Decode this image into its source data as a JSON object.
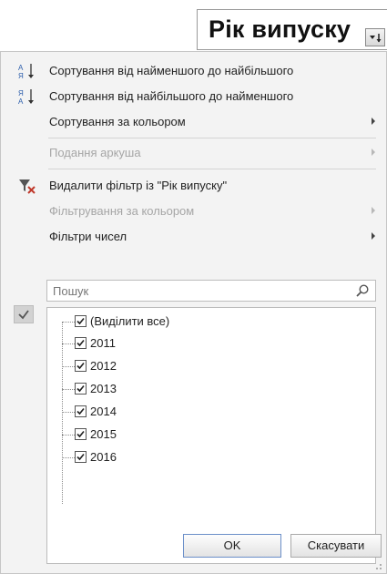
{
  "header": {
    "title": "Рік випуску"
  },
  "menu": {
    "items": [
      {
        "label": "Сортування від найменшого до найбільшого",
        "enabled": true,
        "submenu": false,
        "icon": "sort-ascending-icon"
      },
      {
        "label": "Сортування від найбільшого до найменшого",
        "enabled": true,
        "submenu": false,
        "icon": "sort-descending-icon"
      },
      {
        "label": "Сортування за кольором",
        "enabled": true,
        "submenu": true,
        "icon": ""
      },
      {
        "label": "Подання аркуша",
        "enabled": false,
        "submenu": true,
        "icon": ""
      },
      {
        "label": "Видалити фільтр із \"Рік випуску\"",
        "enabled": true,
        "submenu": false,
        "icon": "clear-filter-icon"
      },
      {
        "label": "Фільтрування за кольором",
        "enabled": false,
        "submenu": true,
        "icon": ""
      },
      {
        "label": "Фільтри чисел",
        "enabled": true,
        "submenu": true,
        "icon": ""
      }
    ]
  },
  "search": {
    "placeholder": "Пошук"
  },
  "tree": {
    "select_all": {
      "label": "(Виділити все)",
      "checked": true
    },
    "items": [
      {
        "label": "2011",
        "checked": true
      },
      {
        "label": "2012",
        "checked": true
      },
      {
        "label": "2013",
        "checked": true
      },
      {
        "label": "2014",
        "checked": true
      },
      {
        "label": "2015",
        "checked": true
      },
      {
        "label": "2016",
        "checked": true
      }
    ]
  },
  "buttons": {
    "ok": "OK",
    "cancel": "Скасувати"
  },
  "colors": {
    "menu_bg": "#f3f3f3",
    "disabled_text": "#a6a6a6",
    "filter_icon_red": "#c0392b",
    "ok_border": "#6b8fc9"
  }
}
